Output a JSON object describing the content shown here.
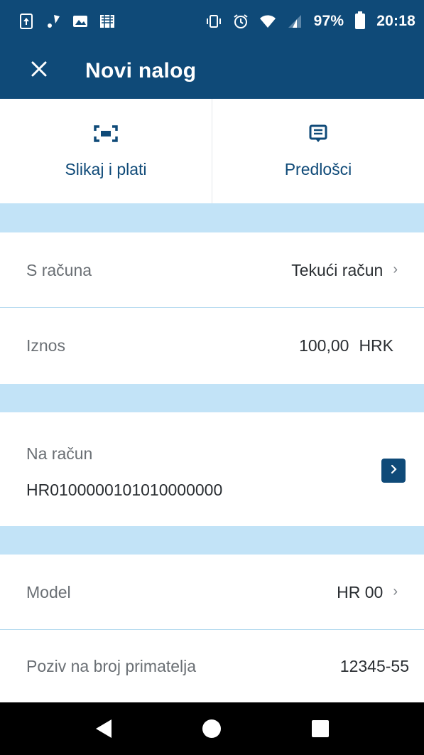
{
  "status_bar": {
    "battery_percent": "97%",
    "time": "20:18",
    "left_icons": [
      "sim-update-icon",
      "notification-icon",
      "image-icon",
      "photo-icon"
    ],
    "right_icons": [
      "vibrate-icon",
      "alarm-icon",
      "wifi-icon",
      "signal-icon",
      "battery-icon"
    ]
  },
  "app_bar": {
    "title": "Novi nalog",
    "close_icon": "close-icon"
  },
  "actions": [
    {
      "label": "Slikaj i plati",
      "icon": "scan-icon"
    },
    {
      "label": "Predlošci",
      "icon": "template-icon"
    }
  ],
  "form": {
    "from_account": {
      "label": "S računa",
      "value": "Tekući račun"
    },
    "amount": {
      "label": "Iznos",
      "value": "100,00",
      "currency": "HRK"
    },
    "to_account": {
      "label": "Na račun",
      "value": "HR0100000101010000000"
    },
    "model": {
      "label": "Model",
      "value": "HR 00"
    },
    "reference": {
      "label": "Poziv na broj primatelja",
      "value": "12345-55"
    }
  },
  "colors": {
    "primary": "#0f4a78",
    "band": "#c2e3f7",
    "divider": "#b8dcf0",
    "label_text": "#6a6f74",
    "value_text": "#2a2e32"
  }
}
